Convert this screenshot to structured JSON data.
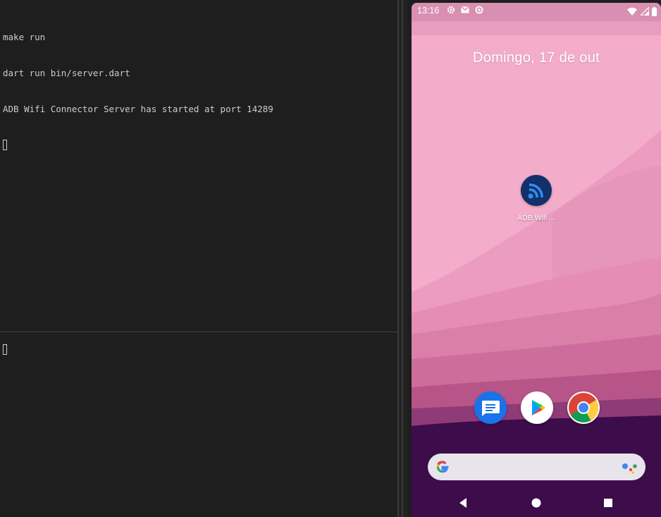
{
  "terminal": {
    "top_pane": {
      "lines": [
        "make run",
        "dart run bin/server.dart",
        "ADB Wifi Connector Server has started at port 14289"
      ]
    },
    "bottom_pane": {}
  },
  "phone": {
    "statusbar": {
      "time": "13:16",
      "left_icons": [
        "settings-icon",
        "gmail-icon",
        "data-saver-icon"
      ],
      "right_icons": [
        "wifi-icon",
        "signal-icon",
        "battery-icon"
      ]
    },
    "date": "Domingo, 17 de out",
    "app": {
      "label": "ADB Wifi ...",
      "icon": "wifi-signal-icon",
      "color": "#12306a"
    },
    "dock": [
      {
        "name": "messages",
        "icon": "messages-icon",
        "color": "#1a73e8"
      },
      {
        "name": "play-store",
        "icon": "play-store-icon"
      },
      {
        "name": "chrome",
        "icon": "chrome-icon"
      }
    ],
    "search": {
      "left_icon": "google-g-icon",
      "right_icon": "assistant-icon"
    },
    "nav": [
      "back-icon",
      "home-icon",
      "recent-apps-icon"
    ]
  }
}
